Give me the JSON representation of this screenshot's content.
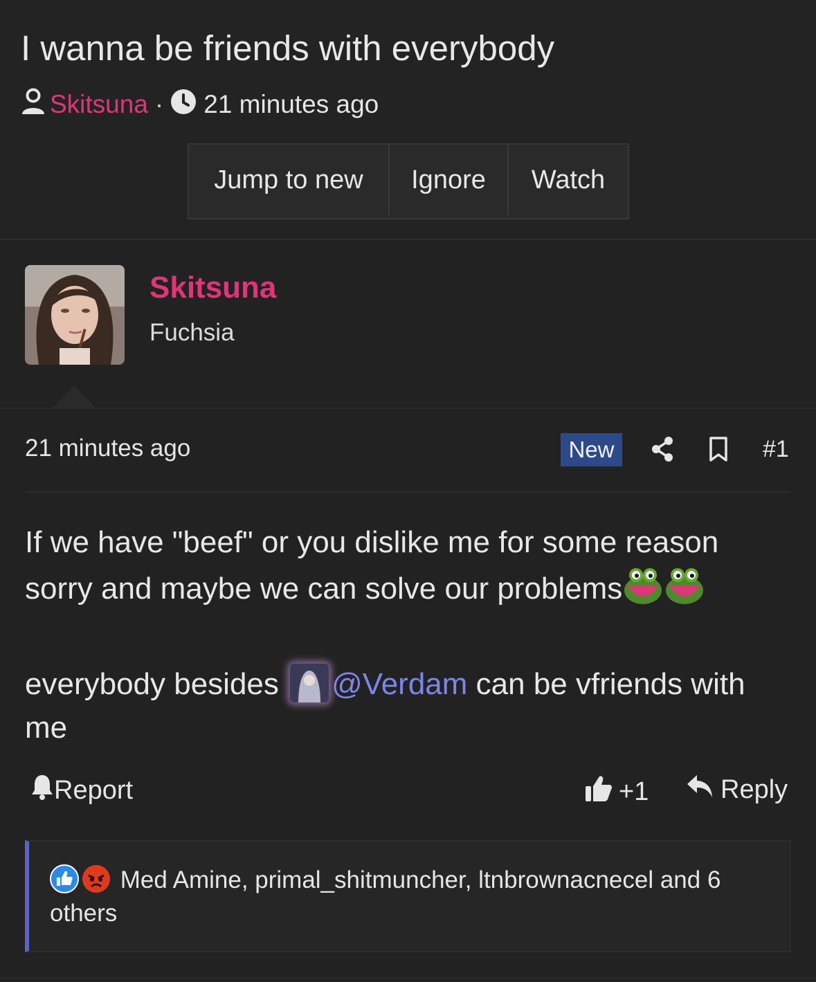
{
  "thread": {
    "title": "I wanna be friends with everybody",
    "author": "Skitsuna",
    "separator": "·",
    "time": "21 minutes ago",
    "buttons": {
      "jump": "Jump to new",
      "ignore": "Ignore",
      "watch": "Watch"
    }
  },
  "user": {
    "name": "Skitsuna",
    "title": "Fuchsia"
  },
  "post": {
    "time": "21 minutes ago",
    "badge": "New",
    "number": "#1",
    "line1": "If we have \"beef\" or you dislike me for some reason sorry and maybe we can solve our problems",
    "line2_before": "everybody besides",
    "mention": "@Verdam",
    "line2_after": "can be vfriends with me"
  },
  "actions": {
    "report": "Report",
    "like": "+1",
    "reply": "Reply"
  },
  "reactions": {
    "text": "Med Amine, primal_shitmuncher, ltnbrownacnecel and 6 others"
  },
  "icons": [
    "user-icon",
    "clock-icon",
    "share-icon",
    "bookmark-icon",
    "bell-icon",
    "thumbs-up-icon",
    "reply-icon",
    "like-reaction-icon",
    "angry-reaction-icon",
    "frog-emoji-icon"
  ],
  "colors": {
    "accent": "#e0357a",
    "mention": "#7b86e8",
    "badge": "#2c4a8a",
    "reaction_border": "#5a63c8"
  }
}
